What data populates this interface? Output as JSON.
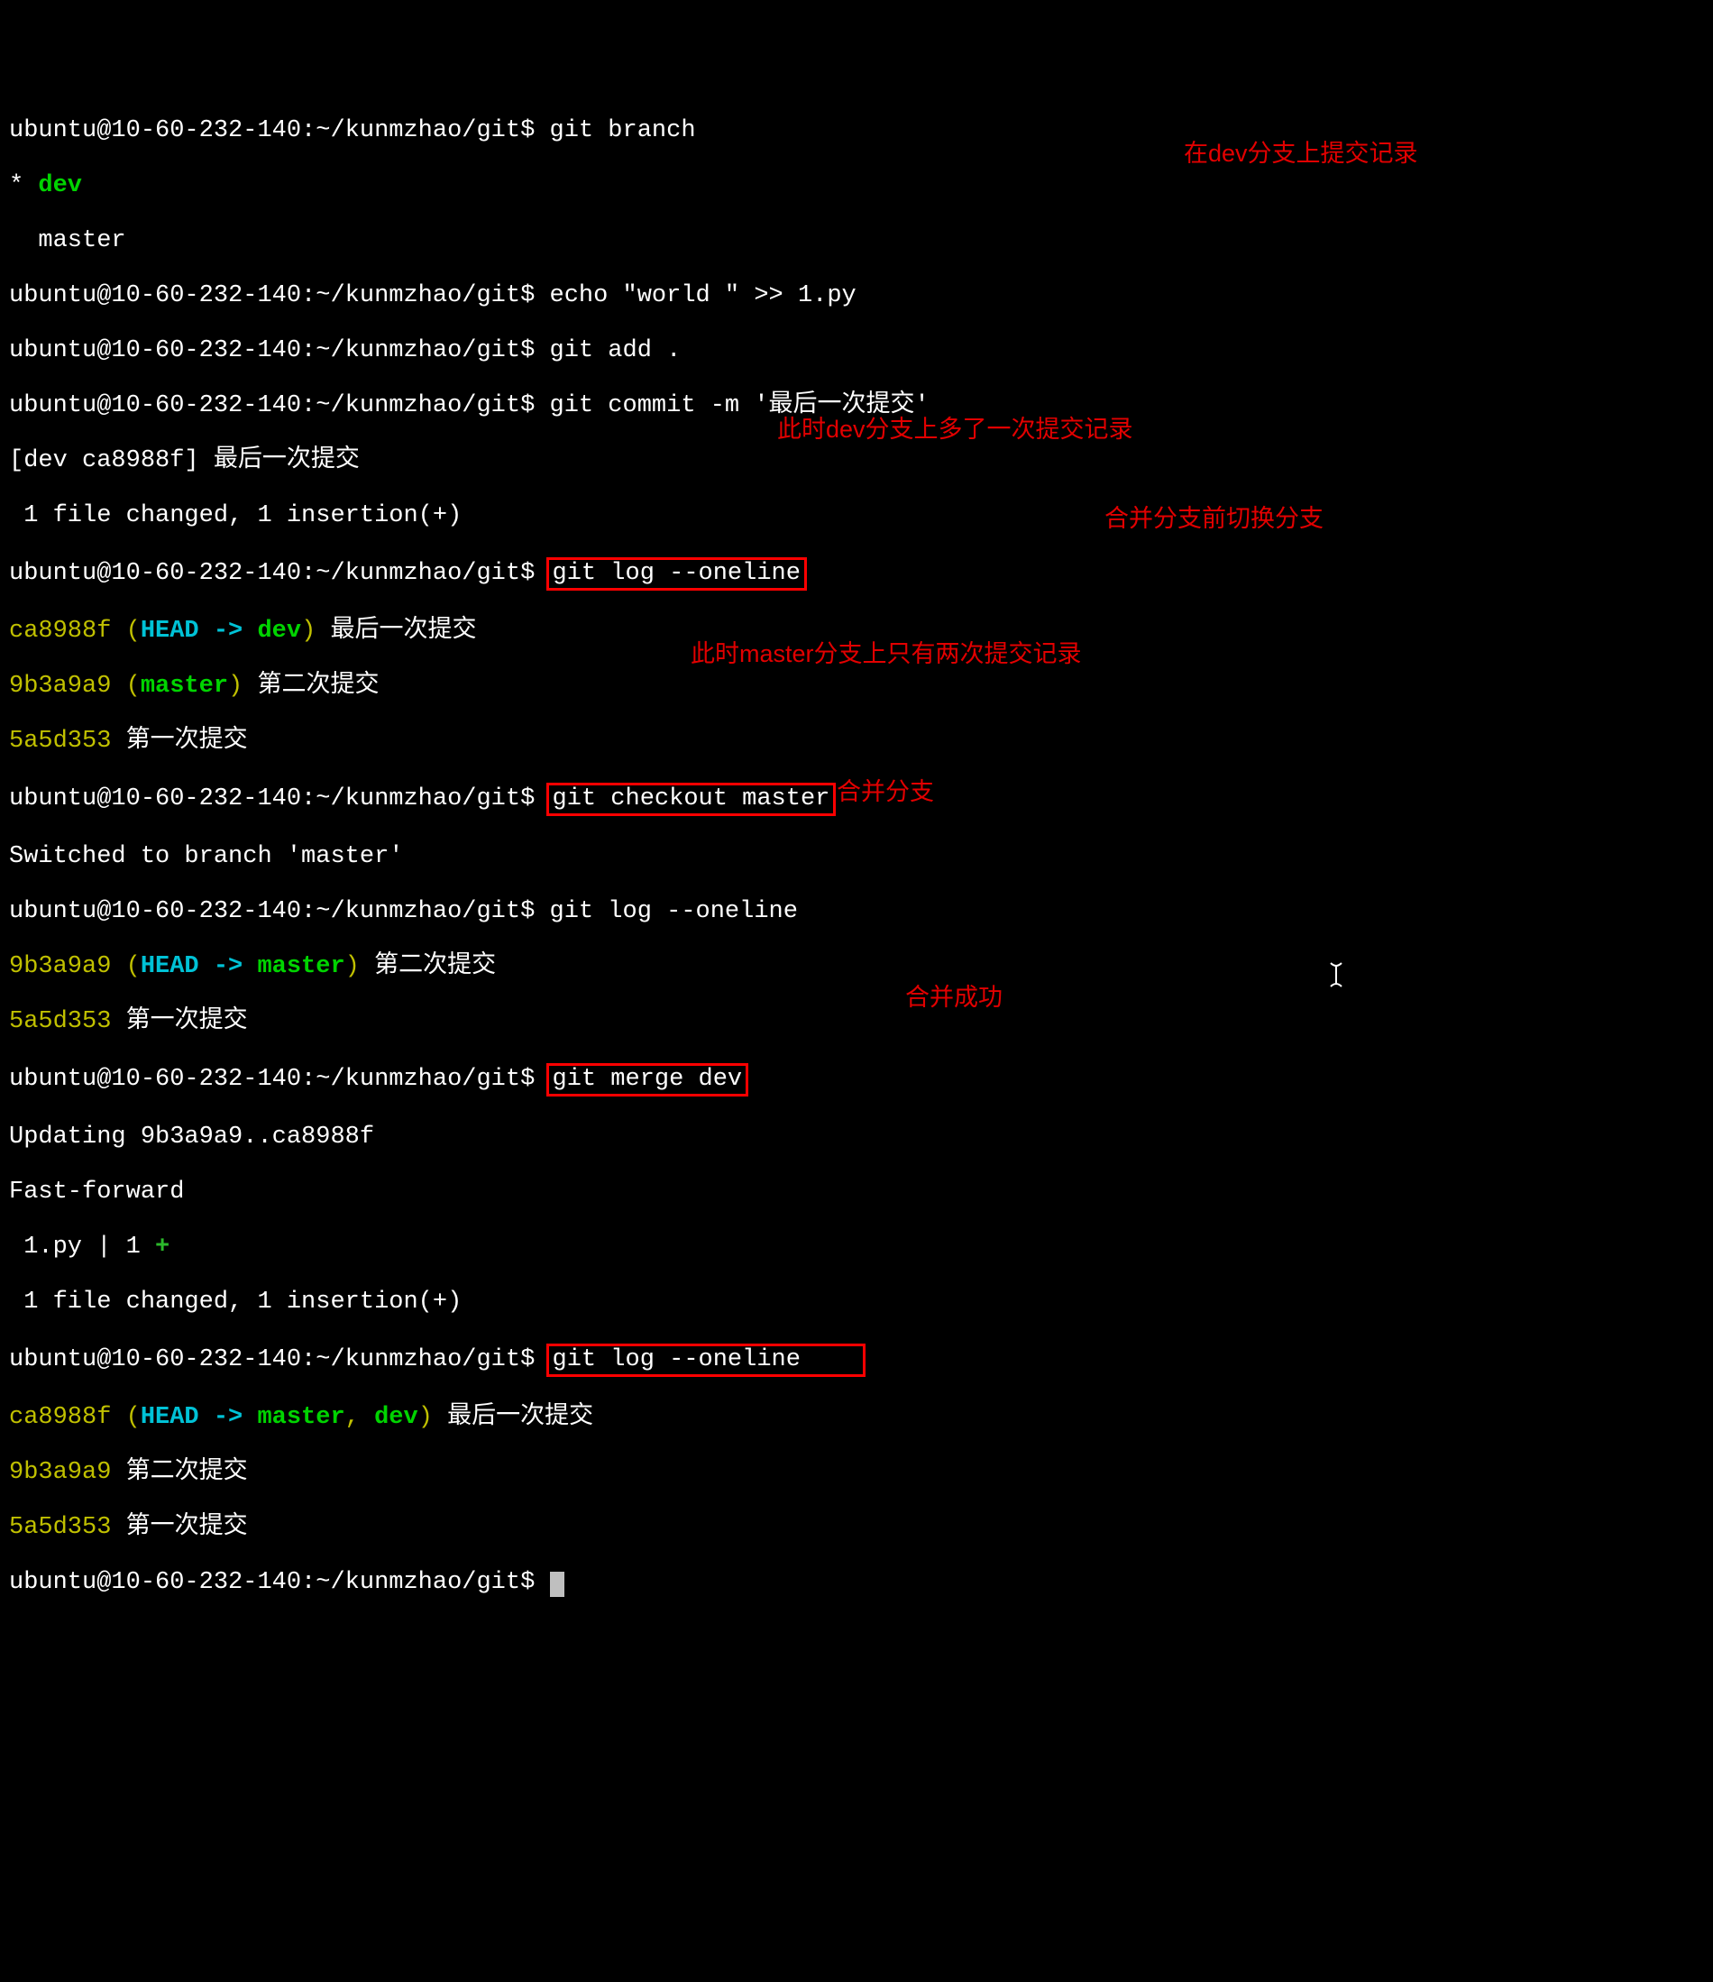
{
  "prompt": "ubuntu@10-60-232-140:~/kunmzhao/git$ ",
  "cmds": {
    "branch": "git branch",
    "echo": "echo \"world \" >> 1.py",
    "add": "git add .",
    "commit": "git commit -m '最后一次提交'",
    "log1": "git log --oneline",
    "checkout": "git checkout master",
    "log2": "git log --oneline",
    "merge": "git merge dev",
    "log3": "git log --oneline"
  },
  "branch_out": {
    "star": "*",
    "dev": " dev",
    "master": "  master"
  },
  "commit_out": {
    "l1": "[dev ca8988f] 最后一次提交",
    "l2": " 1 file changed, 1 insertion(+)"
  },
  "log_devA": {
    "h1": "ca8988f ",
    "p1": "(",
    "head": "HEAD -> ",
    "dev": "dev",
    "p2": ")",
    "m1": " 最后一次提交",
    "h2": "9b3a9a9 ",
    "p3": "(",
    "master": "master",
    "p4": ")",
    "m2": " 第二次提交",
    "h3": "5a5d353",
    "m3": " 第一次提交"
  },
  "switch_out": "Switched to branch 'master'",
  "log_masterA": {
    "h1": "9b3a9a9 ",
    "p1": "(",
    "head": "HEAD -> ",
    "master": "master",
    "p2": ")",
    "m1": " 第二次提交",
    "h2": "5a5d353",
    "m2": " 第一次提交"
  },
  "merge_out": {
    "l1": "Updating 9b3a9a9..ca8988f",
    "l2": "Fast-forward",
    "l3a": " 1.py | 1 ",
    "l3b": "+",
    "l4": " 1 file changed, 1 insertion(+)"
  },
  "log_masterB": {
    "h1": "ca8988f ",
    "p1": "(",
    "head": "HEAD -> ",
    "master": "master",
    "comma": ", ",
    "dev": "dev",
    "p2": ")",
    "m1": " 最后一次提交",
    "h2": "9b3a9a9",
    "m2": " 第二次提交",
    "h3": "5a5d353",
    "m3": " 第一次提交"
  },
  "annotations": {
    "a1": "在dev分支上提交记录",
    "a2": "此时dev分支上多了一次提交记录",
    "a3": "合并分支前切换分支",
    "a4": "此时master分支上只有两次提交记录",
    "a5": "合并分支",
    "a6": "合并成功"
  },
  "ibeam": "I"
}
